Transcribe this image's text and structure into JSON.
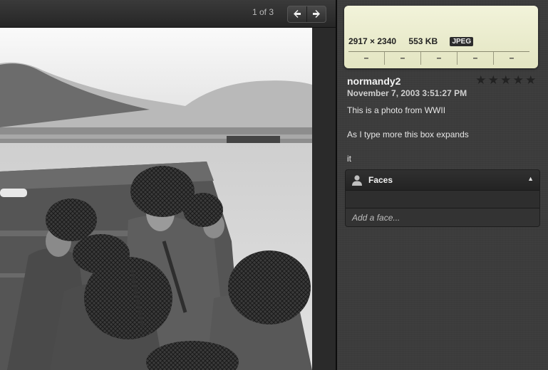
{
  "toolbar": {
    "counter": "1 of 3",
    "prev_icon": "arrow-left-icon",
    "next_icon": "arrow-right-icon",
    "prev_glyph": "🡐",
    "next_glyph": "🡒"
  },
  "photo": {
    "subject": "WWII landing craft with soldiers approaching a beach",
    "palette": "grayscale"
  },
  "info": {
    "dimensions": "2917 × 2340",
    "file_size": "553 KB",
    "format": "JPEG",
    "exif_cells": [
      "–",
      "–",
      "–",
      "–",
      "–"
    ],
    "card_color": "#eef0d2",
    "title": "normandy2",
    "rating": 0,
    "stars": [
      "★",
      "★",
      "★",
      "★",
      "★"
    ],
    "date": "November 7, 2003 3:51:27 PM",
    "caption_lines": [
      "This is a photo from WWII",
      "As I type more this box expands",
      "it"
    ]
  },
  "faces": {
    "label": "Faces",
    "icon": "person-icon",
    "toggle_glyph": "▲",
    "add_placeholder": "Add a face..."
  }
}
